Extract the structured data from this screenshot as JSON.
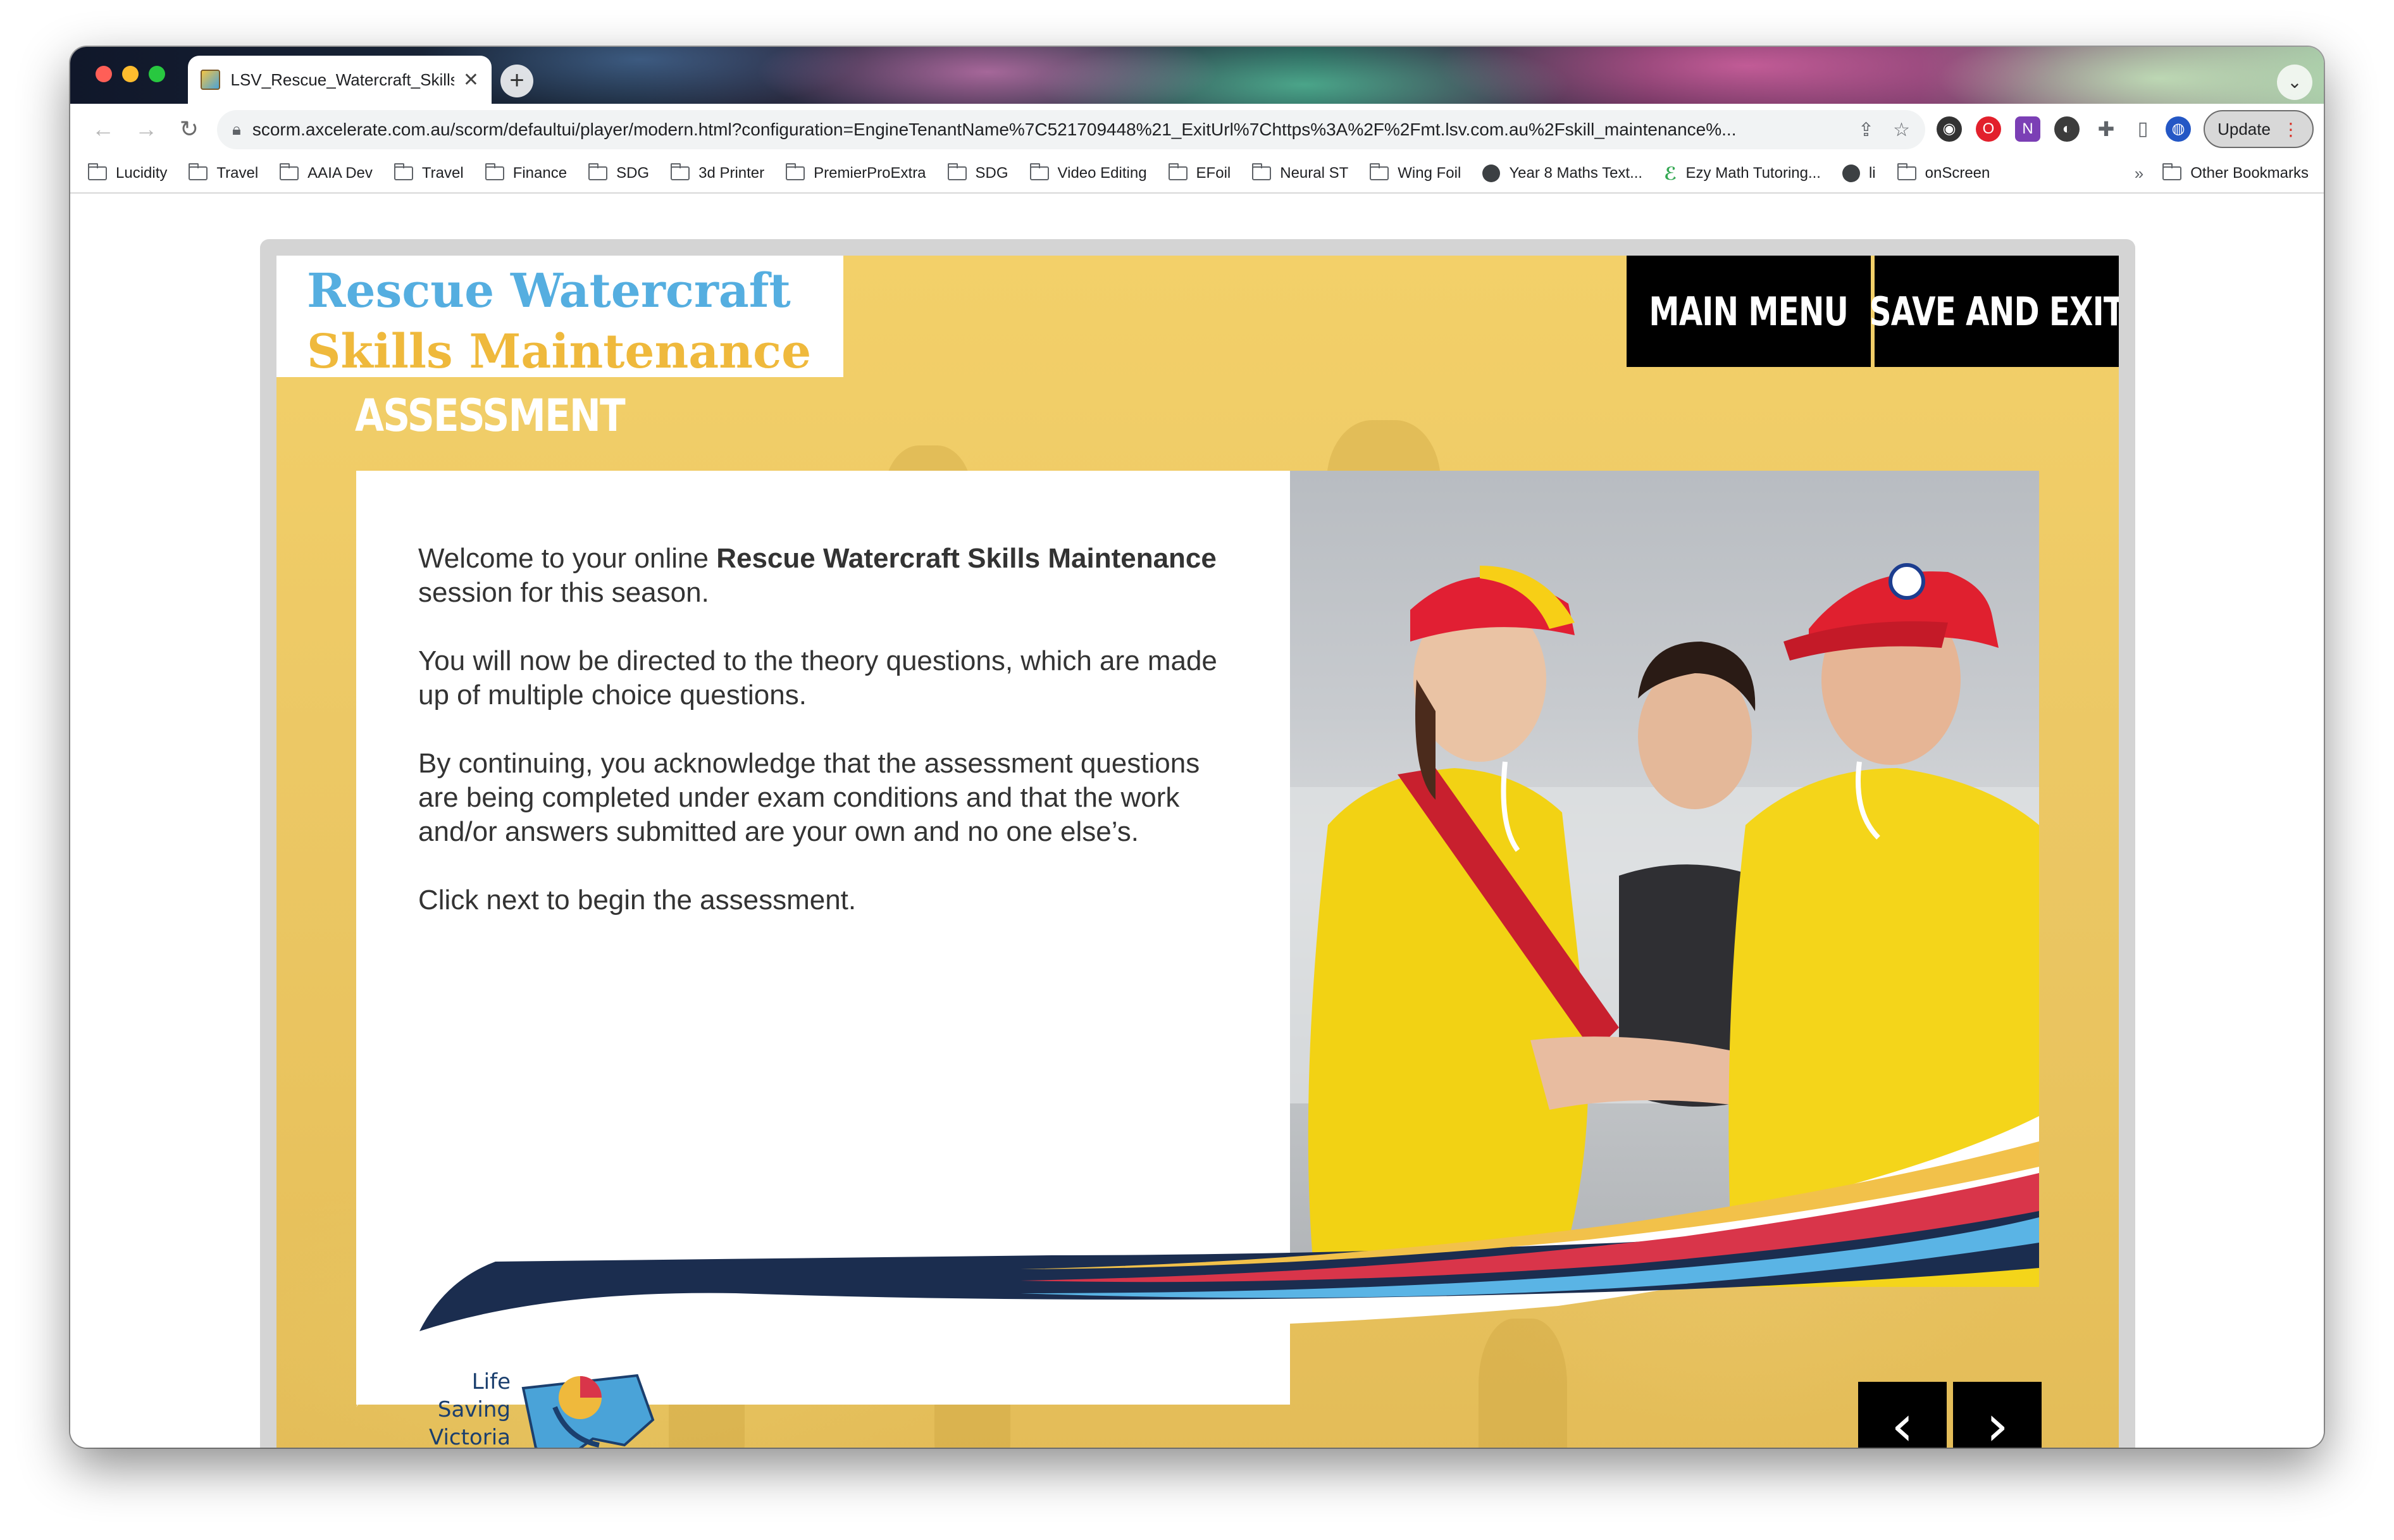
{
  "browser": {
    "tab_title": "LSV_Rescue_Watercraft_Skills",
    "tab_close": "✕",
    "new_tab": "+",
    "url": "scorm.axcelerate.com.au/scorm/defaultui/player/modern.html?configuration=EngineTenantName%7C521709448%21_ExitUrl%7Chttps%3A%2F%2Fmt.lsv.com.au%2Fskill_maintenance%...",
    "update_label": "Update",
    "bookmarks": [
      {
        "label": "Lucidity",
        "icon": "folder-icon"
      },
      {
        "label": "Travel",
        "icon": "folder-icon"
      },
      {
        "label": "AAIA Dev",
        "icon": "folder-icon"
      },
      {
        "label": "Travel",
        "icon": "folder-icon"
      },
      {
        "label": "Finance",
        "icon": "folder-icon"
      },
      {
        "label": "SDG",
        "icon": "folder-icon"
      },
      {
        "label": "3d Printer",
        "icon": "folder-icon"
      },
      {
        "label": "PremierProExtra",
        "icon": "folder-icon"
      },
      {
        "label": "SDG",
        "icon": "folder-icon"
      },
      {
        "label": "Video Editing",
        "icon": "folder-icon"
      },
      {
        "label": "EFoil",
        "icon": "folder-icon"
      },
      {
        "label": "Neural ST",
        "icon": "folder-icon"
      },
      {
        "label": "Wing Foil",
        "icon": "folder-icon"
      },
      {
        "label": "Year 8 Maths Text...",
        "icon": "globe-icon"
      },
      {
        "label": "Ezy Math Tutoring...",
        "icon": "leaf-icon"
      },
      {
        "label": "li",
        "icon": "globe-icon"
      },
      {
        "label": "onScreen",
        "icon": "folder-icon"
      }
    ],
    "bookmarks_more": "»",
    "other_bookmarks": "Other Bookmarks"
  },
  "course": {
    "title_line1": "Rescue Watercraft",
    "title_line2": "Skills Maintenance",
    "main_menu_label": "MAIN MENU",
    "save_exit_label": "SAVE AND EXIT",
    "section_heading": "ASSESSMENT",
    "intro_prefix": "Welcome to your online ",
    "intro_bold": "Rescue Watercraft Skills Maintenance",
    "intro_suffix": " session for this season.",
    "paragraph2": "You will now be directed to the theory questions, which are made up of multiple choice questions.",
    "paragraph3": "By continuing, you acknowledge that the assessment questions are being completed under exam conditions and that the work and/or answers submitted are your own and no one else’s.",
    "paragraph4": "Click next to begin the assessment.",
    "logo_line1": "Life",
    "logo_line2": "Saving",
    "logo_line3": "Victoria",
    "prev_arrow": "‹",
    "next_arrow": "›"
  },
  "colors": {
    "title_blue": "#55aee0",
    "title_gold": "#efb93c",
    "stage_yellow": "#ecc865",
    "button_black": "#000000",
    "swoosh_navy": "#1b2d4f",
    "swoosh_red": "#d9354a",
    "swoosh_lightblue": "#5ab4e5"
  }
}
